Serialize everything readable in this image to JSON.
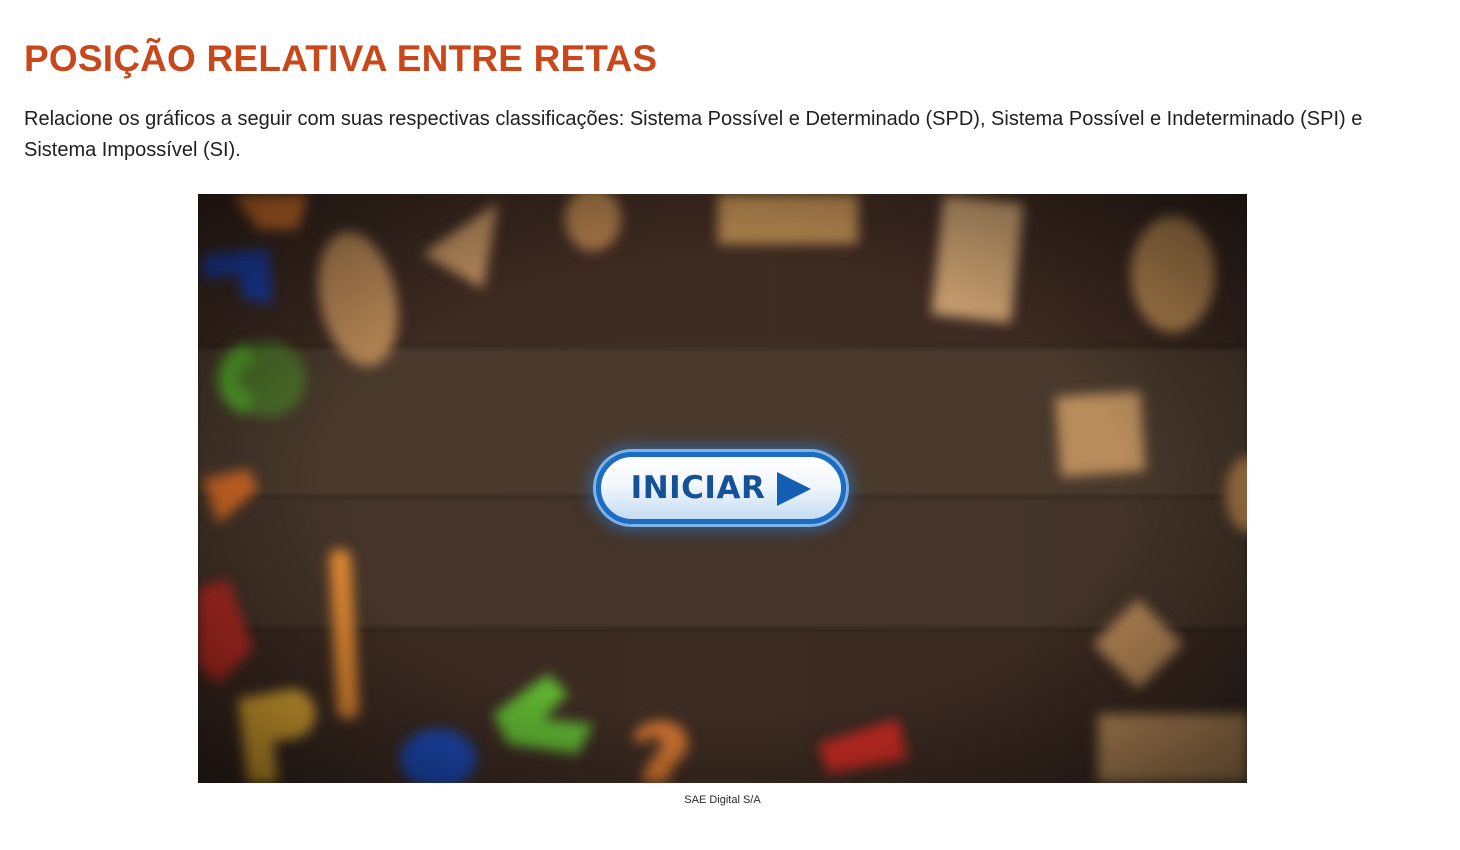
{
  "page": {
    "title": "POSIÇÃO RELATIVA ENTRE RETAS",
    "description": "Relacione os gráficos a seguir com suas respectivas classificações: Sistema Possível e Determinado (SPD), Sistema Possível e Indeterminado (SPI) e Sistema Impossível (SI)."
  },
  "media": {
    "background_image": "blurred-wooden-table-with-letters-and-blocks",
    "start_button": {
      "label": "INICIAR",
      "icon": "play-icon"
    },
    "caption": "SAE Digital S/A"
  },
  "colors": {
    "title": "#c8471b",
    "text": "#1f1f1f",
    "button_border": "#1b6cc4",
    "button_text": "#145196",
    "wood_dark": "#2e2018"
  }
}
